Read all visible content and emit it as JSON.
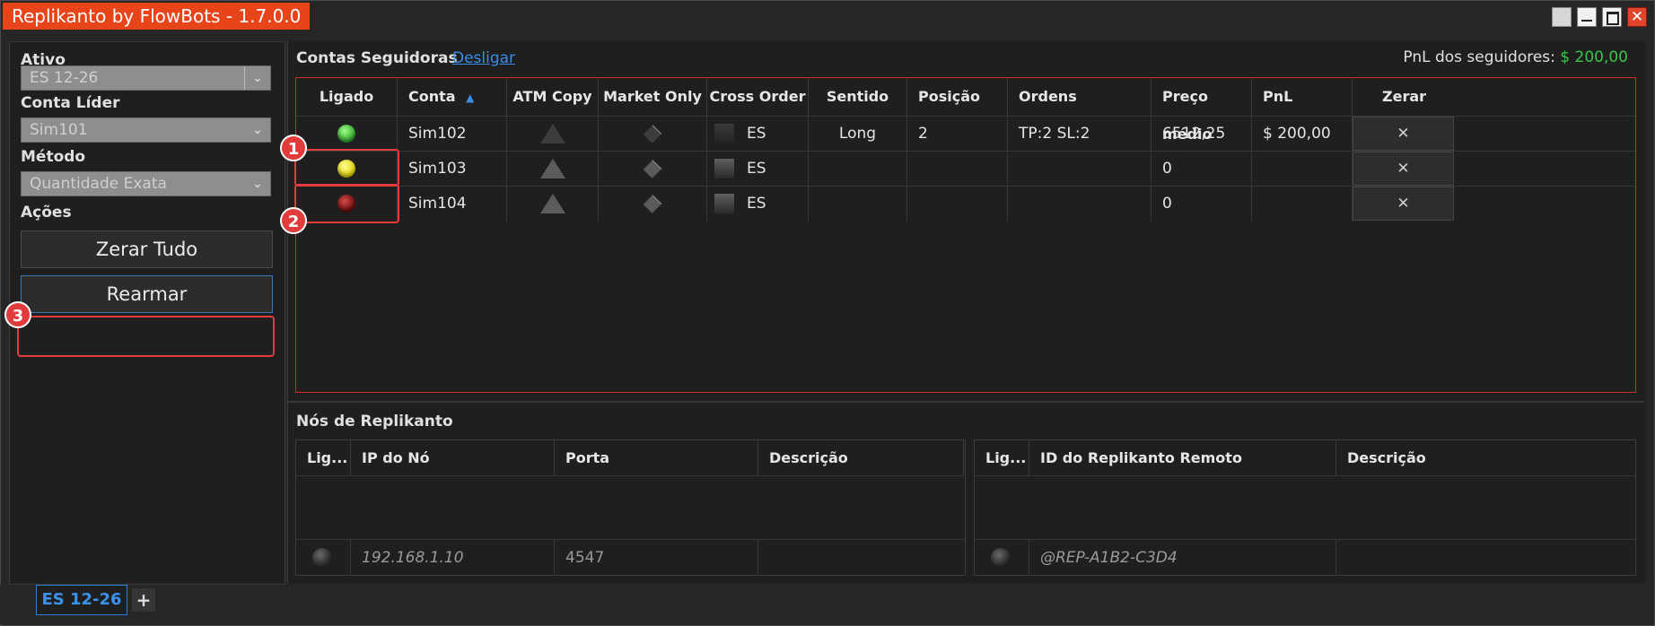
{
  "window": {
    "title": "Replikanto by FlowBots - 1.7.0.0"
  },
  "left": {
    "ativo_label": "Ativo",
    "ativo_value": "ES 12-26",
    "conta_lider_label": "Conta Líder",
    "conta_lider_value": "Sim101",
    "metodo_label": "Método",
    "metodo_value": "Quantidade Exata",
    "acoes_label": "Ações",
    "zerar_tudo": "Zerar Tudo",
    "rearmar": "Rearmar"
  },
  "followers": {
    "title": "Contas Seguidoras",
    "toggle_link": "Desligar",
    "pnl_label": "PnL dos seguidores:",
    "pnl_value": "$ 200,00",
    "columns": [
      "Ligado",
      "Conta",
      "ATM Copy",
      "Market Only",
      "Cross Order",
      "Sentido",
      "Posição",
      "Ordens",
      "Preço médio",
      "PnL",
      "Zerar"
    ],
    "sort_indicator": "▲",
    "rows": [
      {
        "status": "green",
        "conta": "Sim102",
        "cross": "ES",
        "sentido": "Long",
        "posicao": "2",
        "ordens": "TP:2 SL:2",
        "preco": "6512,25",
        "pnl": "$ 200,00",
        "zerar": "✕"
      },
      {
        "status": "yellow",
        "conta": "Sim103",
        "cross": "ES",
        "sentido": "",
        "posicao": "",
        "ordens": "",
        "preco": "0",
        "pnl": "",
        "zerar": "✕"
      },
      {
        "status": "red",
        "conta": "Sim104",
        "cross": "ES",
        "sentido": "",
        "posicao": "",
        "ordens": "",
        "preco": "0",
        "pnl": "",
        "zerar": "✕"
      }
    ]
  },
  "nodes": {
    "title": "Nós de Replikanto",
    "local_columns": [
      "Lig...",
      "IP do Nó",
      "Porta",
      "Descrição"
    ],
    "local_row": {
      "ip": "192.168.1.10",
      "porta": "4547",
      "descricao": ""
    },
    "remote_columns": [
      "Lig...",
      "ID do Replikanto Remoto",
      "Descrição"
    ],
    "remote_row": {
      "id": "@REP-A1B2-C3D4",
      "descricao": ""
    }
  },
  "tabs": {
    "active": "ES 12-26",
    "add": "+"
  },
  "annotations": [
    "1",
    "2",
    "3"
  ],
  "colors": {
    "accent": "#e8441a",
    "link": "#3a8de6",
    "positive": "#39c648",
    "highlight": "#e43a3a"
  }
}
